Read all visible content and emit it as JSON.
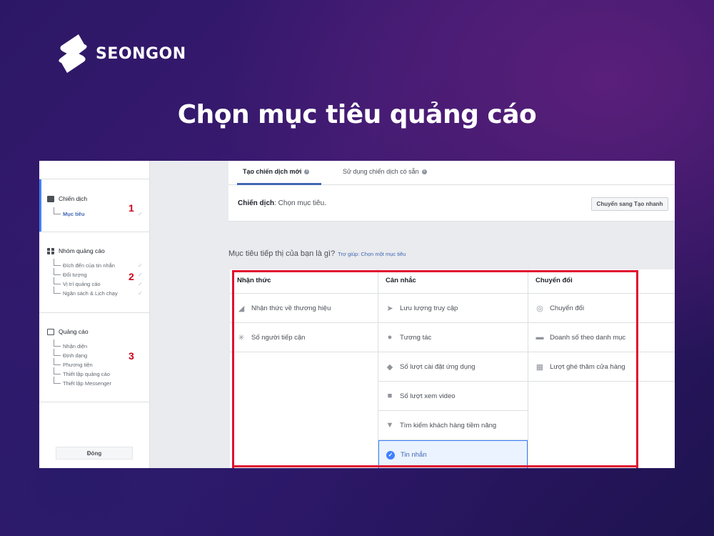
{
  "brand": {
    "name": "SEONGON"
  },
  "headline": "Chọn mục tiêu quảng cáo",
  "sidebar": {
    "sections": [
      {
        "title": "Chiến dịch",
        "items": [
          {
            "label": "Mục tiêu",
            "active": true
          }
        ],
        "marker": "1"
      },
      {
        "title": "Nhóm quảng cáo",
        "items": [
          {
            "label": "Đích đến của tin nhắn"
          },
          {
            "label": "Đối tượng"
          },
          {
            "label": "Vị trí quảng cáo"
          },
          {
            "label": "Ngân sách & Lịch chạy"
          }
        ],
        "marker": "2"
      },
      {
        "title": "Quảng cáo",
        "items": [
          {
            "label": "Nhận diện"
          },
          {
            "label": "Định dạng"
          },
          {
            "label": "Phương tiện"
          },
          {
            "label": "Thiết lập quảng cáo"
          },
          {
            "label": "Thiết lập Messenger"
          }
        ],
        "marker": "3"
      }
    ],
    "close_label": "Đóng",
    "tick": "✓"
  },
  "tabs": [
    {
      "label": "Tạo chiến dịch mới",
      "active": true
    },
    {
      "label": "Sử dụng chiến dịch có sẵn",
      "active": false
    }
  ],
  "campaign": {
    "label": "Chiến dịch",
    "value": ": Chọn mục tiêu."
  },
  "quick_button": "Chuyển sang Tạo nhanh",
  "question": {
    "text": "Mục tiêu tiếp thị của bạn là gì?",
    "help": "Trợ giúp: Chọn một mục tiêu"
  },
  "objectives": [
    {
      "header": "Nhận thức",
      "items": [
        {
          "label": "Nhận thức về thương hiệu",
          "icon": "megaphone-icon",
          "glyph": "◢"
        },
        {
          "label": "Số người tiếp cận",
          "icon": "reach-icon",
          "glyph": "✳"
        }
      ]
    },
    {
      "header": "Cân nhắc",
      "items": [
        {
          "label": "Lưu lượng truy cập",
          "icon": "cursor-icon",
          "glyph": "➤"
        },
        {
          "label": "Tương tác",
          "icon": "people-icon",
          "glyph": "●"
        },
        {
          "label": "Số lượt cài đặt ứng dụng",
          "icon": "box-icon",
          "glyph": "◆"
        },
        {
          "label": "Số lượt xem video",
          "icon": "video-icon",
          "glyph": "■"
        },
        {
          "label": "Tìm kiếm khách hàng tiềm năng",
          "icon": "funnel-icon",
          "glyph": "▼"
        },
        {
          "label": "Tin nhắn",
          "icon": "check-circle-icon",
          "glyph": "✓",
          "selected": true
        }
      ]
    },
    {
      "header": "Chuyển đổi",
      "items": [
        {
          "label": "Chuyển đổi",
          "icon": "globe-icon",
          "glyph": "◎"
        },
        {
          "label": "Doanh số theo danh mục",
          "icon": "cart-icon",
          "glyph": "▬"
        },
        {
          "label": "Lượt ghé thăm cửa hàng",
          "icon": "store-icon",
          "glyph": "▦"
        }
      ]
    }
  ],
  "colors": {
    "accent": "#4267b2",
    "highlight": "#e0102f",
    "selected_bg": "#eaf3ff"
  }
}
